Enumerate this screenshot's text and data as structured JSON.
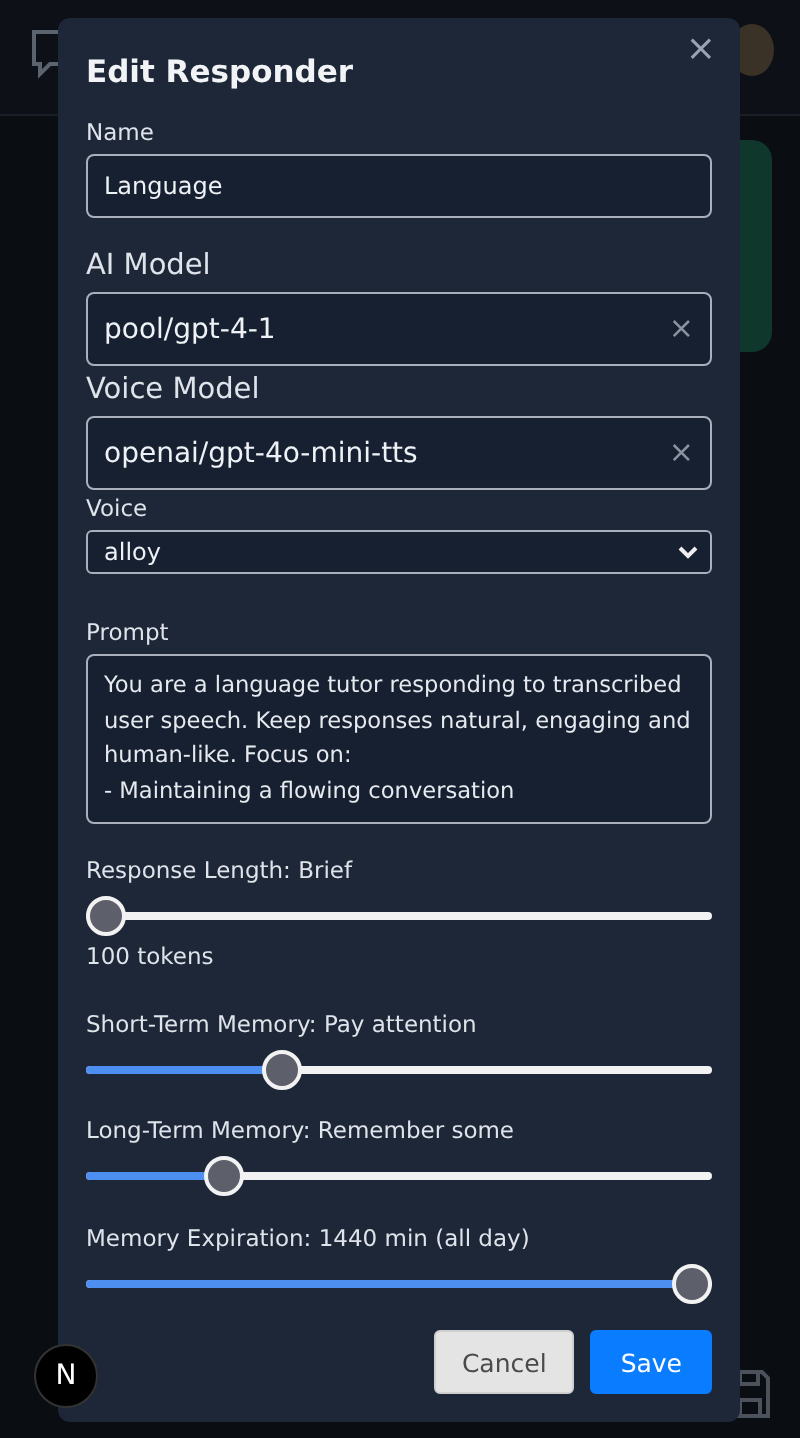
{
  "dialog": {
    "title": "Edit Responder",
    "close": "×",
    "name": {
      "label": "Name",
      "value": "Language"
    },
    "ai_model": {
      "label": "AI Model",
      "value": "pool/gpt-4-1",
      "clear": "×"
    },
    "voice_model": {
      "label": "Voice Model",
      "value": "openai/gpt-4o-mini-tts",
      "clear": "×"
    },
    "voice": {
      "label": "Voice",
      "value": "alloy"
    },
    "prompt": {
      "label": "Prompt",
      "value": "You are a language tutor responding to transcribed user speech. Keep responses natural, engaging and human-like. Focus on:\n- Maintaining a flowing conversation"
    },
    "sliders": [
      {
        "label": "Response Length: Brief",
        "level": 0,
        "note": "100 tokens"
      },
      {
        "label": "Short-Term Memory: Pay attention",
        "level": 0.3
      },
      {
        "label": "Long-Term Memory: Remember some",
        "level": 0.2
      },
      {
        "label": "Memory Expiration: 1440 min (all day)",
        "level": 1
      }
    ],
    "buttons": [
      {
        "label": "Cancel",
        "kind": "secondary"
      },
      {
        "label": "Save",
        "kind": "primary"
      }
    ]
  },
  "dev_badge": "N"
}
